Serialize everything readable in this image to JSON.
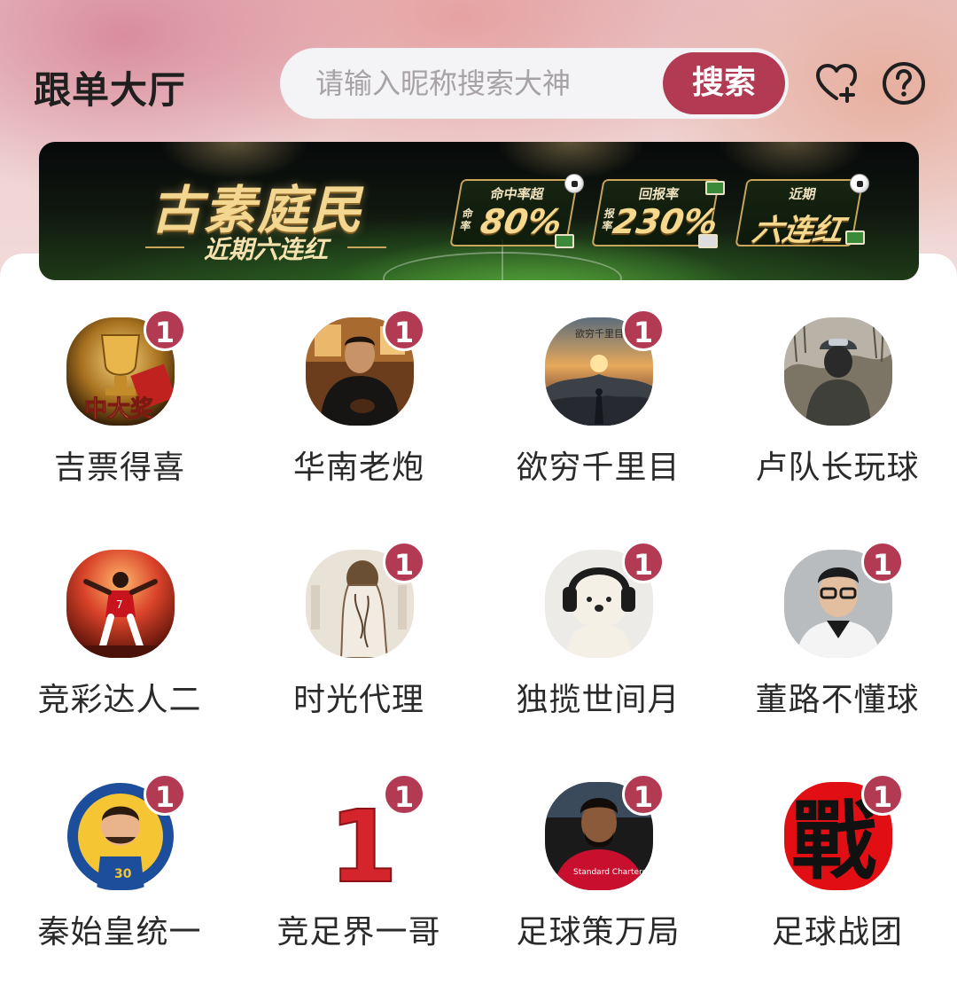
{
  "header": {
    "title": "跟单大厅",
    "search_placeholder": "请输入昵称搜索大神",
    "search_button": "搜索"
  },
  "banner": {
    "name": "古素庭民",
    "subtitle": "近期六连红",
    "stats": [
      {
        "label": "命中率超",
        "side": "命率",
        "value": "80%"
      },
      {
        "label": "回报率",
        "side": "报率",
        "value": "230%"
      },
      {
        "label": "近期",
        "side": "",
        "value": "六连红"
      }
    ]
  },
  "experts": [
    {
      "name": "吉票得喜",
      "badge": "1",
      "avatar_text": "中大奖"
    },
    {
      "name": "华南老炮",
      "badge": "1",
      "avatar_text": ""
    },
    {
      "name": "欲穷千里目",
      "badge": "1",
      "avatar_text": "欲穷千里目"
    },
    {
      "name": "卢队长玩球",
      "badge": "",
      "avatar_text": ""
    },
    {
      "name": "竞彩达人二",
      "badge": "",
      "avatar_text": ""
    },
    {
      "name": "时光代理",
      "badge": "1",
      "avatar_text": ""
    },
    {
      "name": "独揽世间月",
      "badge": "1",
      "avatar_text": ""
    },
    {
      "name": "董路不懂球",
      "badge": "1",
      "avatar_text": ""
    },
    {
      "name": "秦始皇统一",
      "badge": "1",
      "avatar_text": ""
    },
    {
      "name": "竞足界一哥",
      "badge": "1",
      "avatar_text": "1"
    },
    {
      "name": "足球策万局",
      "badge": "1",
      "avatar_text": "Standard Chartered"
    },
    {
      "name": "足球战团",
      "badge": "1",
      "avatar_text": "戰"
    }
  ],
  "colors": {
    "accent": "#b23a52",
    "text": "#2a2a2a",
    "gold": "#f3d68f"
  }
}
